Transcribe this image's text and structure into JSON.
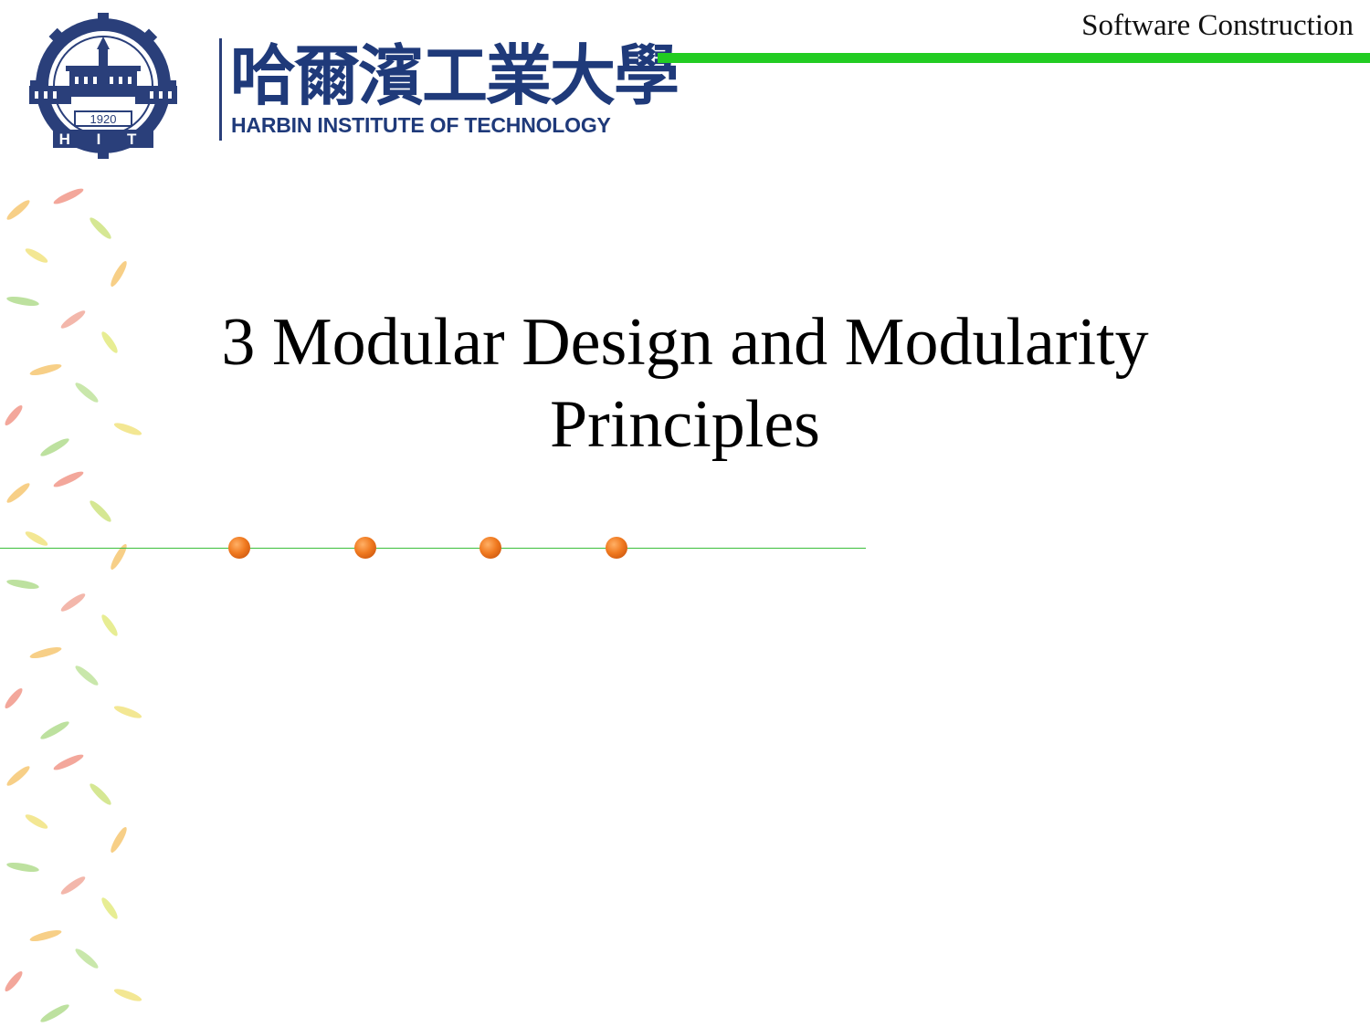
{
  "header": {
    "course_name": "Software Construction",
    "logo_cn": "哈爾濱工業大學",
    "logo_en": "HARBIN INSTITUTE OF TECHNOLOGY",
    "emblem_year": "1920",
    "emblem_letters": "H I T"
  },
  "slide": {
    "title_line1": "3 Modular Design and Modularity",
    "title_line2": "Principles"
  },
  "colors": {
    "accent_green": "#22cc22",
    "logo_blue": "#1f3a7a",
    "bullet_orange": "#f07a20"
  }
}
